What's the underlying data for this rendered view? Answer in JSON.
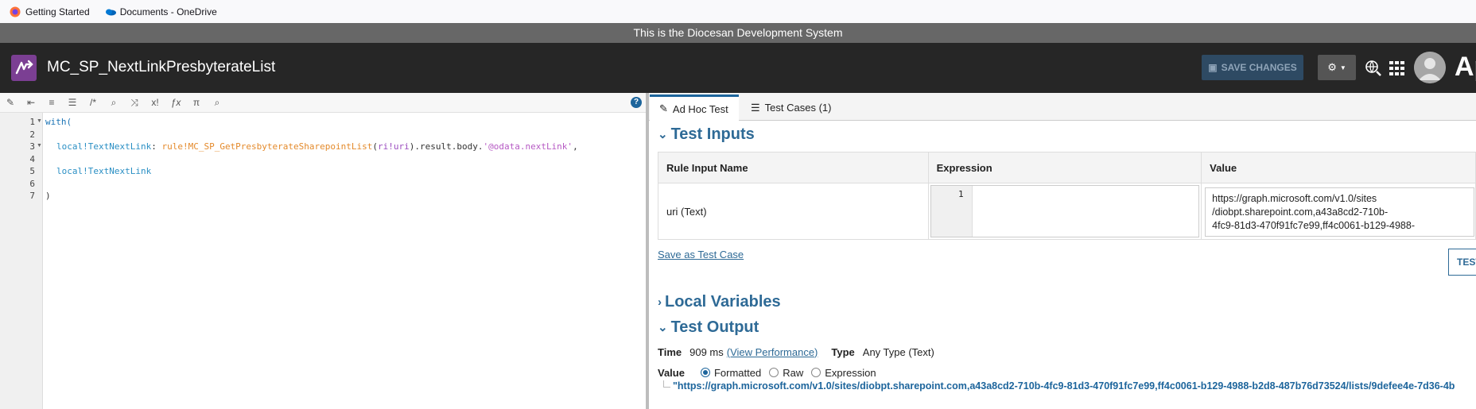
{
  "bookmarks": [
    {
      "label": "Getting Started",
      "icon": "firefox-icon"
    },
    {
      "label": "Documents - OneDrive",
      "icon": "onedrive-icon"
    }
  ],
  "banner": "This is the Diocesan Development System",
  "header": {
    "rule_name": "MC_SP_NextLinkPresbyterateList",
    "save_label": "SAVE CHANGES",
    "brand": "Ap"
  },
  "editor": {
    "line_numbers": [
      "1",
      "2",
      "3",
      "4",
      "5",
      "6",
      "7"
    ],
    "lines": {
      "l1": "with(",
      "l3_var": "local!TextNextLink",
      "l3_sep": ": ",
      "l3_rule": "rule!MC_SP_GetPresbyterateSharepointList",
      "l3_p1": "(",
      "l3_ri": "ri!uri",
      "l3_p2": ").result.body.",
      "l3_str": "'@odata.nextLink'",
      "l3_end": ",",
      "l5_var": "local!TextNextLink",
      "l7": ")"
    }
  },
  "tabs": {
    "adhoc": "Ad Hoc Test",
    "cases": "Test Cases (1)"
  },
  "test_inputs": {
    "title": "Test Inputs",
    "columns": [
      "Rule Input Name",
      "Expression",
      "Value"
    ],
    "rows": [
      {
        "name": "uri (Text)",
        "expr_line": "1",
        "value_lines": [
          "https://graph.microsoft.com/v1.0/sites",
          "/diobpt.sharepoint.com,a43a8cd2-710b-",
          "4fc9-81d3-470f91fc7e99,ff4c0061-b129-4988-"
        ]
      }
    ],
    "save_link": "Save as Test Case",
    "test_button": "TEST"
  },
  "local_variables": {
    "title": "Local Variables"
  },
  "test_output": {
    "title": "Test Output",
    "time_label": "Time",
    "time_value": "909 ms",
    "perf_link": "(View Performance)",
    "type_label": "Type",
    "type_value": "Any Type (Text)",
    "value_label": "Value",
    "modes": [
      "Formatted",
      "Raw",
      "Expression"
    ],
    "selected_mode": "Formatted",
    "output": "\"https://graph.microsoft.com/v1.0/sites/diobpt.sharepoint.com,a43a8cd2-710b-4fc9-81d3-470f91fc7e99,ff4c0061-b129-4988-b2d8-487b76d73524/lists/9defee4e-7d36-4b"
  },
  "colors": {
    "accent": "#1d659c",
    "header_bg": "#262626",
    "banner_bg": "#676767",
    "logo_bg": "#7b3f93"
  }
}
